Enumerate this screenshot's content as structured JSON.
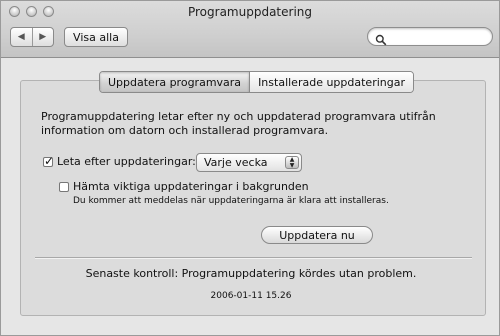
{
  "window": {
    "title": "Programuppdatering"
  },
  "toolbar": {
    "back_icon": "◀",
    "forward_icon": "▶",
    "show_all": "Visa alla",
    "search_value": ""
  },
  "tabs": [
    {
      "label": "Uppdatera programvara",
      "active": true
    },
    {
      "label": "Installerade uppdateringar",
      "active": false
    }
  ],
  "content": {
    "description": "Programuppdatering letar efter ny och uppdaterad programvara utifrån information om datorn och installerad programvara.",
    "check_label": "Leta efter uppdateringar:",
    "check_checked": true,
    "frequency_value": "Varje vecka",
    "download_label": "Hämta viktiga uppdateringar i bakgrunden",
    "download_checked": false,
    "download_note": "Du kommer att meddelas när uppdateringarna är klara att installeras.",
    "update_button": "Uppdatera nu",
    "status_text": "Senaste kontroll: Programuppdatering kördes utan problem.",
    "timestamp": "2006-01-11 15.26"
  },
  "colors": {
    "window_bg": "#e6e6e6",
    "panel_bg": "#dcdcdc"
  }
}
